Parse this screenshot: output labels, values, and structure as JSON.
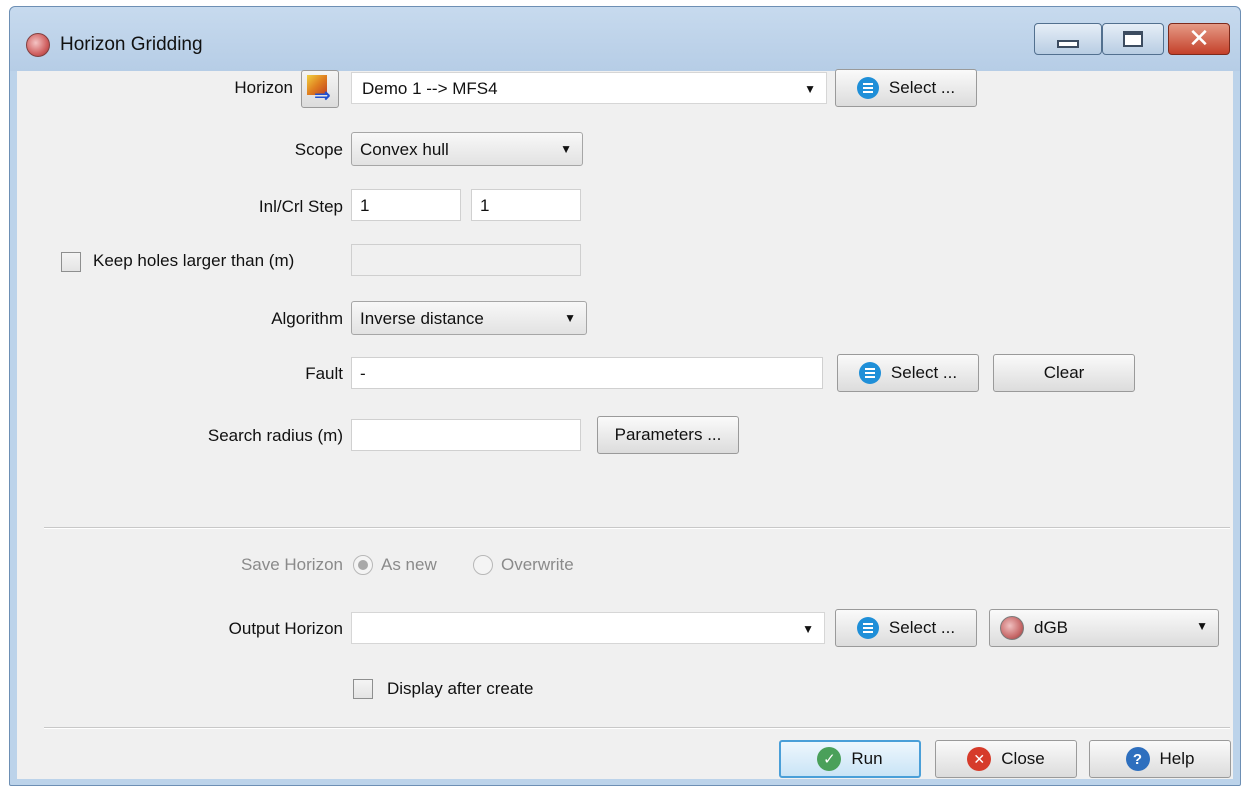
{
  "window": {
    "title": "Horizon Gridding"
  },
  "horizon": {
    "label": "Horizon",
    "value": "Demo 1 --> MFS4",
    "select_label": "Select ..."
  },
  "scope": {
    "label": "Scope",
    "value": "Convex hull"
  },
  "step": {
    "label": "Inl/Crl Step",
    "inline_value": "1",
    "crossline_value": "1"
  },
  "holes": {
    "label": "Keep holes larger than (m)",
    "checked": false,
    "value": ""
  },
  "algorithm": {
    "label": "Algorithm",
    "value": "Inverse distance"
  },
  "fault": {
    "label": "Fault",
    "value": "-",
    "select_label": "Select ...",
    "clear_label": "Clear"
  },
  "search": {
    "label": "Search radius (m)",
    "value": "",
    "parameters_label": "Parameters ..."
  },
  "save": {
    "label": "Save Horizon",
    "option_new": "As new",
    "option_overwrite": "Overwrite",
    "selected": "As new"
  },
  "output": {
    "label": "Output Horizon",
    "value": "",
    "select_label": "Select ...",
    "storage_value": "dGB"
  },
  "display": {
    "label": "Display after create",
    "checked": false
  },
  "footer": {
    "run_label": "Run",
    "close_label": "Close",
    "help_label": "Help"
  }
}
